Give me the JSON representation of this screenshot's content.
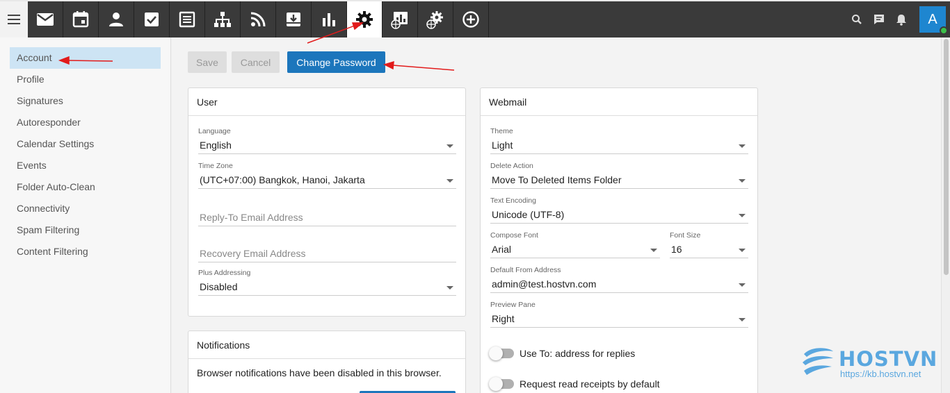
{
  "topbar": {
    "nav_icons": [
      "mail-icon",
      "calendar-icon",
      "contacts-icon",
      "tasks-icon",
      "notes-icon",
      "sitemap-icon",
      "rss-icon",
      "archive-download-icon",
      "reports-icon",
      "settings-icon",
      "domain-reports-icon",
      "domain-settings-icon",
      "add-circle-icon"
    ],
    "active_icon": "settings-icon",
    "avatar_letter": "A",
    "accent_color": "#1e86d0",
    "status_color": "#3cc04a"
  },
  "sidebar": {
    "items": [
      {
        "label": "Account"
      },
      {
        "label": "Profile"
      },
      {
        "label": "Signatures"
      },
      {
        "label": "Autoresponder"
      },
      {
        "label": "Calendar Settings"
      },
      {
        "label": "Events"
      },
      {
        "label": "Folder Auto-Clean"
      },
      {
        "label": "Connectivity"
      },
      {
        "label": "Spam Filtering"
      },
      {
        "label": "Content Filtering"
      }
    ],
    "active": "Account"
  },
  "toolbar": {
    "save_label": "Save",
    "cancel_label": "Cancel",
    "change_password_label": "Change Password"
  },
  "user_card": {
    "title": "User",
    "language_label": "Language",
    "language_value": "English",
    "timezone_label": "Time Zone",
    "timezone_value": "(UTC+07:00) Bangkok, Hanoi, Jakarta",
    "reply_to_placeholder": "Reply-To Email Address",
    "recovery_placeholder": "Recovery Email Address",
    "plus_label": "Plus Addressing",
    "plus_value": "Disabled"
  },
  "notifications_card": {
    "title": "Notifications",
    "message": "Browser notifications have been disabled in this browser."
  },
  "webmail_card": {
    "title": "Webmail",
    "theme_label": "Theme",
    "theme_value": "Light",
    "delete_label": "Delete Action",
    "delete_value": "Move To Deleted Items Folder",
    "encoding_label": "Text Encoding",
    "encoding_value": "Unicode (UTF-8)",
    "compose_font_label": "Compose Font",
    "compose_font_value": "Arial",
    "font_size_label": "Font Size",
    "font_size_value": "16",
    "from_label": "Default From Address",
    "from_value": "admin@test.hostvn.com",
    "preview_label": "Preview Pane",
    "preview_value": "Right",
    "toggle_replies": "Use To: address for replies",
    "toggle_receipts": "Request read receipts by default"
  },
  "watermark": {
    "brand": "HOSTVN",
    "url": "https://kb.hostvn.net"
  }
}
